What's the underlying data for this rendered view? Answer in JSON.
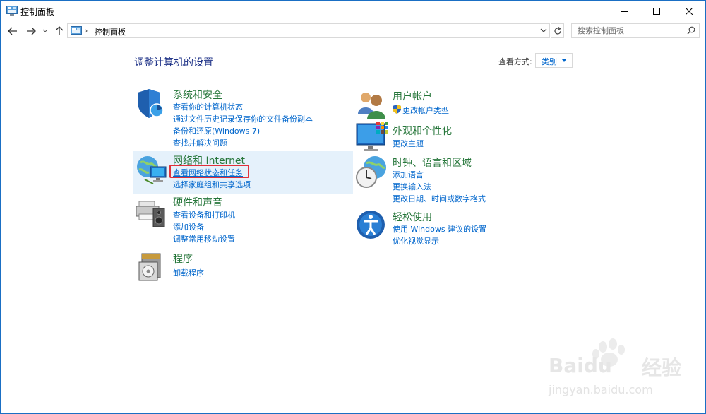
{
  "window": {
    "title": "控制面板"
  },
  "address_bar": {
    "path_item": "控制面板",
    "search_placeholder": "搜索控制面板"
  },
  "main": {
    "heading": "调整计算机的设置",
    "view_by_label": "查看方式:",
    "view_by_value": "类别"
  },
  "categories_left": [
    {
      "title": "系统和安全",
      "links": [
        "查看你的计算机状态",
        "通过文件历史记录保存你的文件备份副本",
        "备份和还原(Windows 7)",
        "查找并解决问题"
      ]
    },
    {
      "title": "网络和 Internet",
      "links": [
        "查看网络状态和任务",
        "选择家庭组和共享选项"
      ]
    },
    {
      "title": "硬件和声音",
      "links": [
        "查看设备和打印机",
        "添加设备",
        "调整常用移动设置"
      ]
    },
    {
      "title": "程序",
      "links": [
        "卸载程序"
      ]
    }
  ],
  "categories_right": [
    {
      "title": "用户帐户",
      "links": [
        "更改帐户类型"
      ]
    },
    {
      "title": "外观和个性化",
      "links": [
        "更改主题"
      ]
    },
    {
      "title": "时钟、语言和区域",
      "links": [
        "添加语言",
        "更换输入法",
        "更改日期、时间或数字格式"
      ]
    },
    {
      "title": "轻松使用",
      "links": [
        "使用 Windows 建议的设置",
        "优化视觉显示"
      ]
    }
  ],
  "watermark": {
    "brand": "Baidu",
    "brand_cn": "经验",
    "url": "jingyan.baidu.com"
  },
  "colors": {
    "accent_blue": "#0066cc",
    "category_green": "#26763a",
    "heading_navy": "#1e3287",
    "highlight_bg": "#e5f1fb",
    "annotation_red": "#e2313a"
  }
}
